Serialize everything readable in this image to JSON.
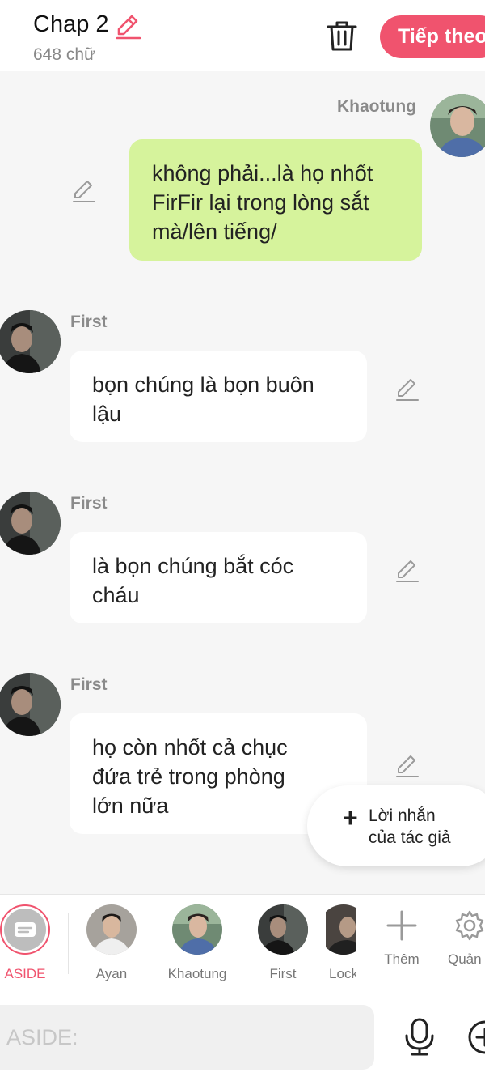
{
  "header": {
    "title": "Chap 2",
    "word_count": "648 chữ",
    "next_label": "Tiếp theo"
  },
  "messages": [
    {
      "speaker": "Khaotung",
      "side": "right",
      "text": [
        "không phải...là họ nhốt",
        "FirFir lại trong lòng sắt",
        "mà/lên tiếng/"
      ]
    },
    {
      "speaker": "First",
      "side": "left",
      "text": [
        "bọn chúng là bọn buôn",
        "lậu"
      ]
    },
    {
      "speaker": "First",
      "side": "left",
      "text": [
        "là bọn chúng bắt cóc",
        "cháu"
      ]
    },
    {
      "speaker": "First",
      "side": "left",
      "text": [
        "họ còn nhốt cả chục",
        "đứa trẻ trong phòng",
        "lớn nữa"
      ]
    }
  ],
  "author_note": {
    "line1": "Lời nhắn",
    "line2": "của tác giả"
  },
  "characters": [
    {
      "name": "ASIDE",
      "selected": true
    },
    {
      "name": "Ayan"
    },
    {
      "name": "Khaotung"
    },
    {
      "name": "First"
    },
    {
      "name": "Lock"
    },
    {
      "name": "Thêm",
      "icon": "plus-icon"
    },
    {
      "name": "Quản lý",
      "icon": "gear-icon"
    }
  ],
  "input": {
    "placeholder": "ASIDE:"
  },
  "colors": {
    "accent": "#f0536e",
    "my_bubble": "#d6f39c",
    "other_bubble": "#ffffff",
    "background": "#f6f6f6"
  }
}
